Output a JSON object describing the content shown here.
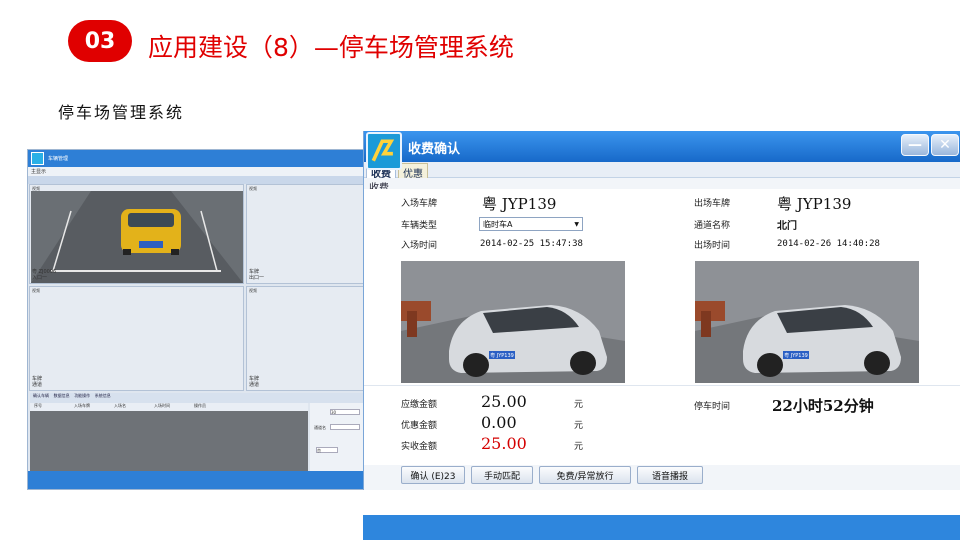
{
  "slide": {
    "badge": "03",
    "title": "应用建设（8）—停车场管理系统",
    "subtitle": "停车场管理系统",
    "accent_color": "#e00000"
  },
  "mini_app": {
    "window_title": "车辆管理",
    "menu_label": "主显示",
    "cam_caption": "视频",
    "cam_plate_text": "粤 ZJ0096",
    "cam_channel": "入口一",
    "pane_caption": "视频",
    "pane_side_labels": [
      "车牌",
      "出口一"
    ],
    "pane_bottom_labels": [
      "车牌",
      "通道"
    ],
    "tabs": [
      "确认车辆",
      "数据信息",
      "功能操作",
      "系统信息"
    ],
    "table_headers": [
      "序号",
      "入场车牌",
      "入场名",
      "入场时间",
      "操作员"
    ],
    "side_panel": {
      "field_value": "30",
      "channel_label": "通道名",
      "select_value": "京"
    }
  },
  "dialog": {
    "title": "收费确认",
    "window_buttons": [
      "minimize-icon",
      "close-icon"
    ],
    "tabs": [
      {
        "label": "收费",
        "active": true
      },
      {
        "label": "优惠",
        "active": false
      }
    ],
    "section_label": "收费",
    "entry": {
      "plate_label": "入场车牌",
      "plate": "粤 JYP139",
      "type_label": "车辆类型",
      "type_value": "临时车A",
      "time_label": "入场时间",
      "time": "2014-02-25 15:47:38"
    },
    "exit": {
      "plate_label": "出场车牌",
      "plate": "粤 JYP139",
      "channel_label": "通道名称",
      "channel": "北门",
      "time_label": "出场时间",
      "time": "2014-02-26 14:40:28"
    },
    "photo_plate_text": "粤 JYP139",
    "fees": {
      "due_label": "应缴金额",
      "due": "25.00",
      "discount_label": "优惠金额",
      "discount": "0.00",
      "paid_label": "实收金额",
      "paid": "25.00",
      "unit": "元",
      "duration_label": "停车时间",
      "duration": "22小时52分钟"
    },
    "buttons": [
      "确认 (E)23",
      "手动匹配",
      "免费/异常放行",
      "语音播报"
    ]
  }
}
